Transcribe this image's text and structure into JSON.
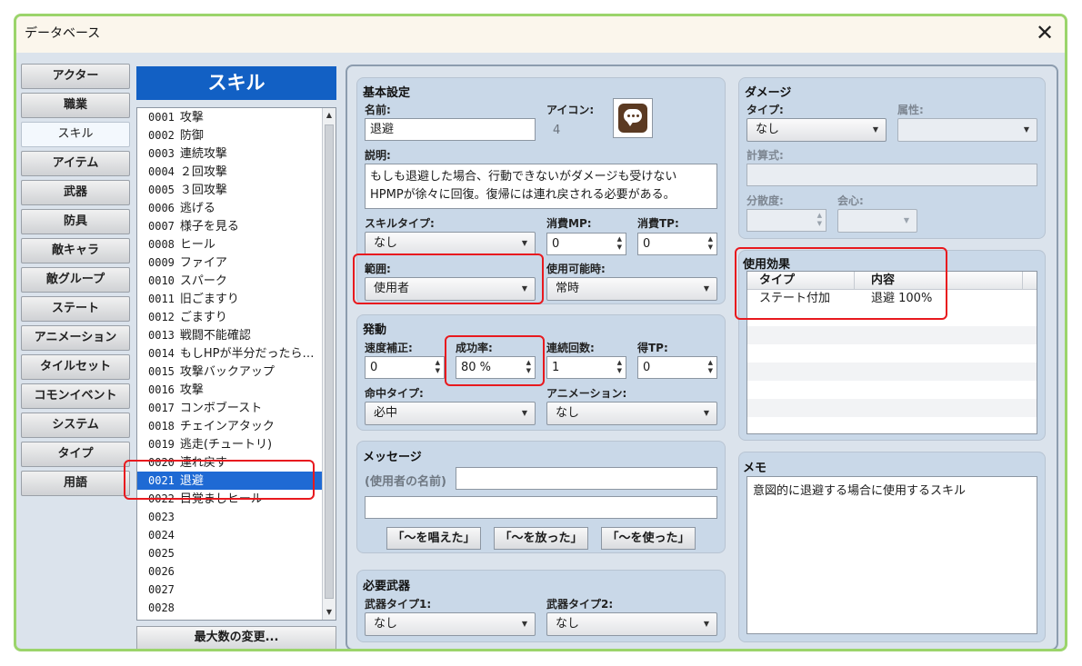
{
  "window": {
    "title": "データベース"
  },
  "tabs": [
    "アクター",
    "職業",
    "スキル",
    "アイテム",
    "武器",
    "防具",
    "敵キャラ",
    "敵グループ",
    "ステート",
    "アニメーション",
    "タイルセット",
    "コモンイベント",
    "システム",
    "タイプ",
    "用語"
  ],
  "active_tab": "スキル",
  "list": {
    "header": "スキル",
    "max_button": "最大数の変更...",
    "rows": [
      {
        "id": "0001",
        "name": "攻撃"
      },
      {
        "id": "0002",
        "name": "防御"
      },
      {
        "id": "0003",
        "name": "連続攻撃"
      },
      {
        "id": "0004",
        "name": "２回攻撃"
      },
      {
        "id": "0005",
        "name": "３回攻撃"
      },
      {
        "id": "0006",
        "name": "逃げる"
      },
      {
        "id": "0007",
        "name": "様子を見る"
      },
      {
        "id": "0008",
        "name": "ヒール"
      },
      {
        "id": "0009",
        "name": "ファイア"
      },
      {
        "id": "0010",
        "name": "スパーク"
      },
      {
        "id": "0011",
        "name": "旧ごますり"
      },
      {
        "id": "0012",
        "name": "ごますり"
      },
      {
        "id": "0013",
        "name": "戦闘不能確認"
      },
      {
        "id": "0014",
        "name": "もしHPが半分だったら…"
      },
      {
        "id": "0015",
        "name": "攻撃バックアップ"
      },
      {
        "id": "0016",
        "name": "攻撃"
      },
      {
        "id": "0017",
        "name": "コンボブースト"
      },
      {
        "id": "0018",
        "name": "チェインアタック"
      },
      {
        "id": "0019",
        "name": "逃走(チュートリ)"
      },
      {
        "id": "0020",
        "name": "連れ戻す"
      },
      {
        "id": "0021",
        "name": "退避"
      },
      {
        "id": "0022",
        "name": "目覚ましヒール"
      },
      {
        "id": "0023",
        "name": ""
      },
      {
        "id": "0024",
        "name": ""
      },
      {
        "id": "0025",
        "name": ""
      },
      {
        "id": "0026",
        "name": ""
      },
      {
        "id": "0027",
        "name": ""
      },
      {
        "id": "0028",
        "name": ""
      }
    ],
    "selected_id": "0021"
  },
  "basic": {
    "title": "基本設定",
    "name_label": "名前:",
    "name_value": "退避",
    "icon_label": "アイコン:",
    "icon_index": "4",
    "icon_name": "speech-bubble-icon",
    "desc_label": "説明:",
    "desc_line1": "もしも退避した場合、行動できないがダメージも受けない",
    "desc_line2": "HPMPが徐々に回復。復帰には連れ戻される必要がある。",
    "skilltype_label": "スキルタイプ:",
    "skilltype_value": "なし",
    "mp_label": "消費MP:",
    "mp_value": "0",
    "tp_label": "消費TP:",
    "tp_value": "0",
    "scope_label": "範囲:",
    "scope_value": "使用者",
    "occasion_label": "使用可能時:",
    "occasion_value": "常時"
  },
  "invocation": {
    "title": "発動",
    "speed_label": "速度補正:",
    "speed_value": "0",
    "success_label": "成功率:",
    "success_value": "80 %",
    "repeat_label": "連続回数:",
    "repeat_value": "1",
    "tpgain_label": "得TP:",
    "tpgain_value": "0",
    "hittype_label": "命中タイプ:",
    "hittype_value": "必中",
    "animation_label": "アニメーション:",
    "animation_value": "なし"
  },
  "message": {
    "title": "メッセージ",
    "user_name_label": "(使用者の名前)",
    "line1": "",
    "line2": "",
    "buttons": [
      "「～を唱えた」",
      "「～を放った」",
      "「～を使った」"
    ]
  },
  "weapon": {
    "title": "必要武器",
    "type1_label": "武器タイプ1:",
    "type1_value": "なし",
    "type2_label": "武器タイプ2:",
    "type2_value": "なし"
  },
  "damage": {
    "title": "ダメージ",
    "type_label": "タイプ:",
    "type_value": "なし",
    "element_label": "属性:",
    "element_value": "",
    "formula_label": "計算式:",
    "formula_value": "",
    "variance_label": "分散度:",
    "variance_value": "",
    "critical_label": "会心:",
    "critical_value": ""
  },
  "effects": {
    "title": "使用効果",
    "columns": [
      "タイプ",
      "内容"
    ],
    "rows": [
      {
        "type": "ステート付加",
        "content": "退避 100%"
      }
    ]
  },
  "memo": {
    "title": "メモ",
    "text": "意図的に退避する場合に使用するスキル"
  },
  "colors": {
    "highlight": "#e8191e",
    "selection": "#1f6ad4",
    "window_border": "#9bd46b"
  }
}
